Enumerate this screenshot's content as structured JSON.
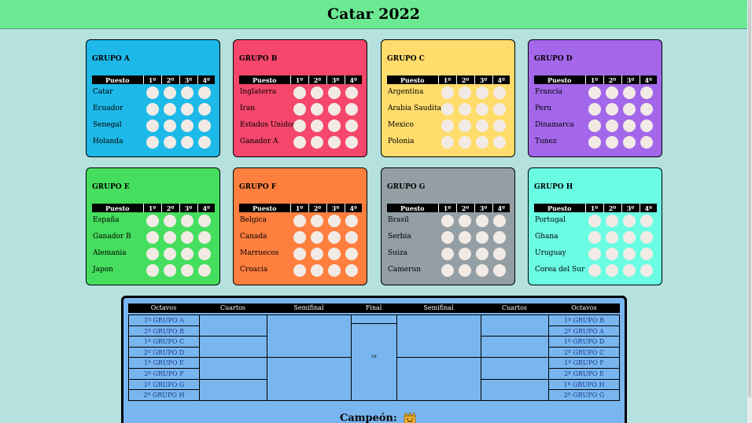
{
  "title": "Catar 2022",
  "table_headers": [
    "Puesto",
    "1º",
    "2º",
    "3º",
    "4º"
  ],
  "groups": [
    {
      "name": "GRUPO A",
      "color": "#1db9e8",
      "teams": [
        "Catar",
        "Ecuador",
        "Senegal",
        "Holanda"
      ]
    },
    {
      "name": "GRUPO B",
      "color": "#f4476b",
      "teams": [
        "Inglaterra",
        "Iran",
        "Estados Unidos",
        "Ganador A"
      ]
    },
    {
      "name": "GRUPO C",
      "color": "#ffdc6b",
      "teams": [
        "Argentina",
        "Arabia Saudita",
        "Mexico",
        "Polonia"
      ]
    },
    {
      "name": "GRUPO D",
      "color": "#a467ea",
      "teams": [
        "Francia",
        "Peru",
        "Dinamarca",
        "Tunez"
      ]
    },
    {
      "name": "GRUPO E",
      "color": "#46de5e",
      "teams": [
        "España",
        "Ganador B",
        "Alemania",
        "Japon"
      ]
    },
    {
      "name": "GRUPO F",
      "color": "#ff7f3f",
      "teams": [
        "Belgica",
        "Canada",
        "Marruecos",
        "Croacia"
      ]
    },
    {
      "name": "GRUPO G",
      "color": "#949ea5",
      "teams": [
        "Brasil",
        "Serbia",
        "Suiza",
        "Camerun"
      ]
    },
    {
      "name": "GRUPO H",
      "color": "#6afde3",
      "teams": [
        "Portugal",
        "Ghana",
        "Uruguay",
        "Corea del Sur"
      ]
    }
  ],
  "bracket": {
    "headers": [
      "Octavos",
      "Cuartos",
      "Semifinal",
      "Final",
      "Semifinal",
      "Cuartos",
      "Octavos"
    ],
    "left_octavos": [
      "1º GRUPO A",
      "2º GRUPO B",
      "1º GRUPO C",
      "2º GRUPO D",
      "1º GRUPO E",
      "2º GRUPO F",
      "1º GRUPO G",
      "2º GRUPO H"
    ],
    "right_octavos": [
      "1º GRUPO B",
      "2º GRUPO A",
      "1º GRUPO D",
      "2º GRUPO C",
      "1º GRUPO F",
      "2º GRUPO E",
      "1º GRUPO H",
      "2º GRUPO G"
    ],
    "vs": "vs",
    "champion_label": "Campeón:"
  }
}
